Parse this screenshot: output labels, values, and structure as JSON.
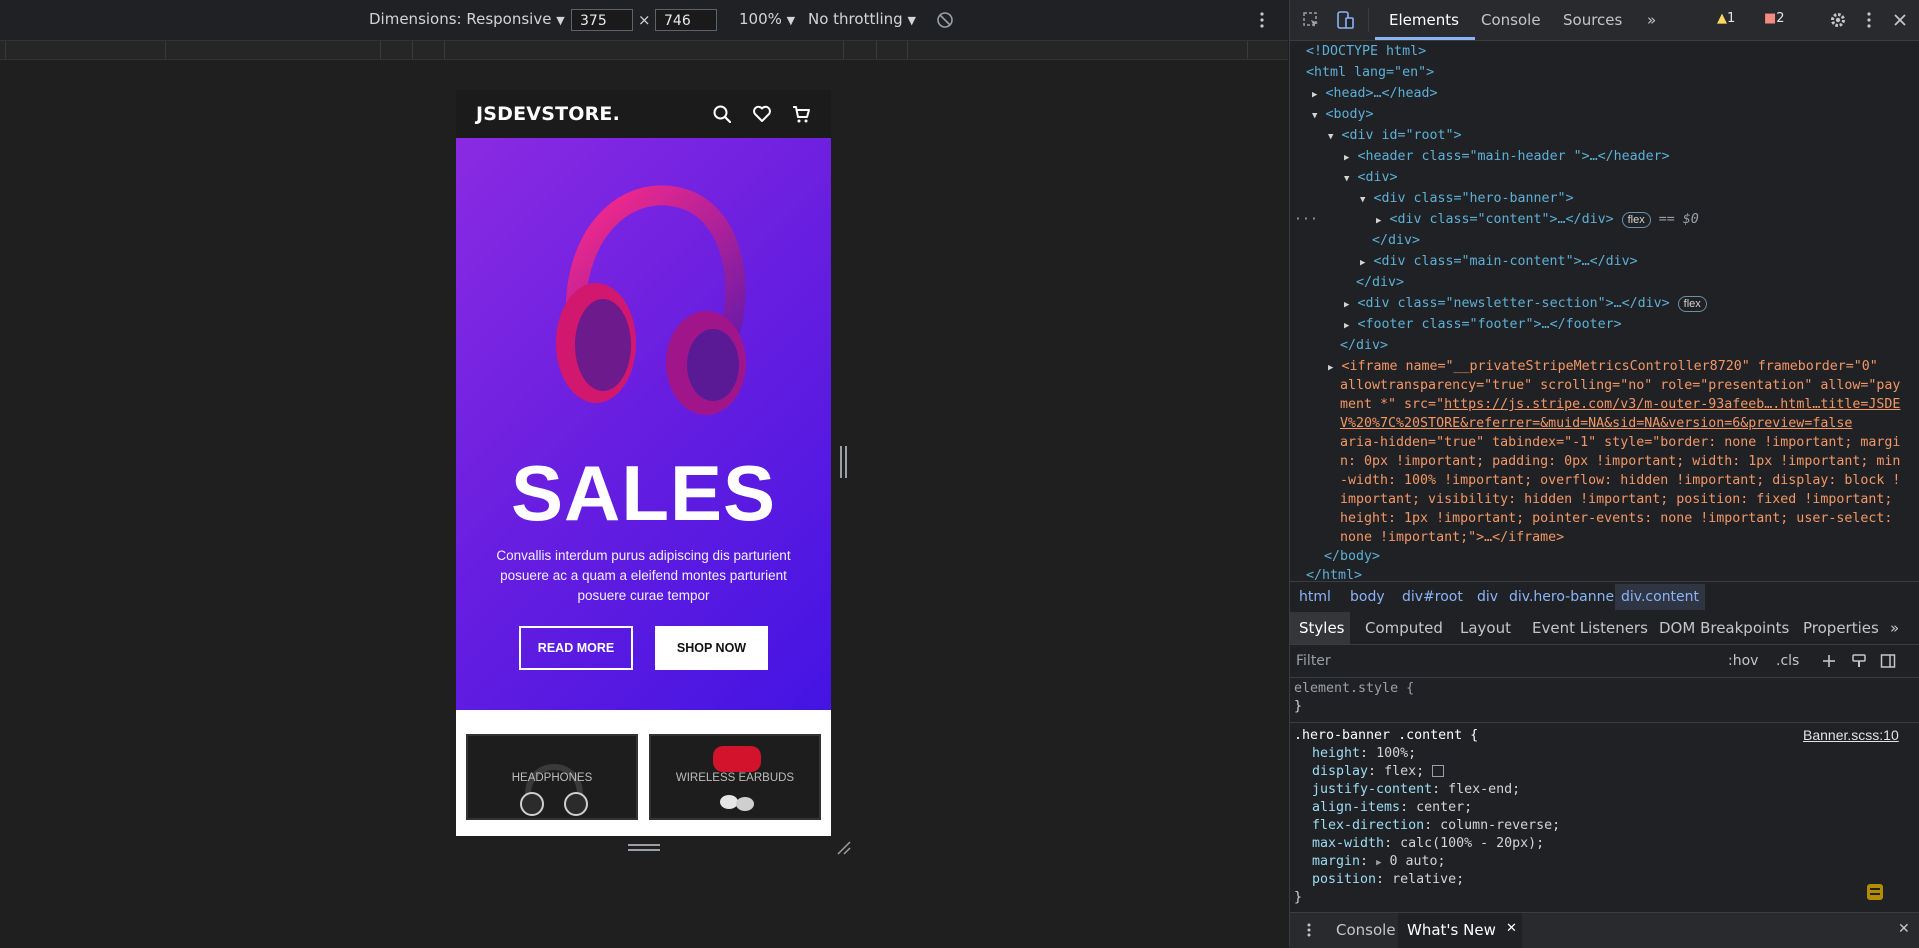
{
  "device_toolbar": {
    "dimensions_label": "Dimensions: Responsive",
    "width_value": "375",
    "times": "×",
    "height_value": "746",
    "zoom": "100%",
    "throttling": "No throttling",
    "caret": "▼"
  },
  "site": {
    "logo": "JSDEVSTORE.",
    "hero_title": "SALES",
    "hero_description": "Convallis interdum purus adipiscing dis parturient posuere ac a quam a eleifend montes parturient posuere curae tempor",
    "read_more": "READ MORE",
    "shop_now": "SHOP NOW",
    "categories": [
      "HEADPHONES",
      "WIRELESS EARBUDS"
    ]
  },
  "devtools": {
    "tabs": [
      "Elements",
      "Console",
      "Sources"
    ],
    "more_tabs": "»",
    "warnings": "1",
    "errors": "2",
    "dom": {
      "doctype": "<!DOCTYPE html>",
      "html_open": "<html lang=\"en\">",
      "head": "<head>…</head>",
      "body_open": "<body>",
      "div_root": "<div id=\"root\">",
      "header": "<header class=\"main-header \">…</header>",
      "div_open": "<div>",
      "hero_banner": "<div class=\"hero-banner\">",
      "content": "<div class=\"content\">…</div>",
      "flex_pill": "flex",
      "selected_marker": "== $0",
      "div_close": "</div>",
      "main_content": "<div class=\"main-content\">…</div>",
      "newsletter": "<div class=\"newsletter-section\">…</div>",
      "footer": "<footer class=\"footer\">…</footer>",
      "iframe_1": "<iframe name=\"__privateStripeMetricsController8720\" frameborder=\"0\"",
      "iframe_2": "allowtransparency=\"true\" scrolling=\"no\" role=\"presentation\" allow=\"pay",
      "iframe_3": "ment *\" src=\"",
      "iframe_link_1": "https://js.stripe.com/v3/m-outer-93afeeb….html…title=JSDE",
      "iframe_link_2": "V%20%7C%20STORE&referrer=&muid=NA&sid=NA&version=6&preview=false",
      "iframe_4": "aria-hidden=\"true\" tabindex=\"-1\" style=\"border: none !important; margi",
      "iframe_5": "n: 0px !important; padding: 0px !important; width: 1px !important; min",
      "iframe_6": "-width: 100% !important; overflow: hidden !important; display: block !",
      "iframe_7": "important; visibility: hidden !important; position: fixed !important;",
      "iframe_8": "height: 1px !important; pointer-events: none !important; user-select:",
      "iframe_9": "none !important;\">…</iframe>",
      "body_close": "</body>",
      "html_close": "</html>",
      "ellipsis": "···"
    },
    "breadcrumbs": [
      "html",
      "body",
      "div#root",
      "div",
      "div.hero-banner",
      "div.content"
    ],
    "styles_tabs": [
      "Styles",
      "Computed",
      "Layout",
      "Event Listeners",
      "DOM Breakpoints",
      "Properties"
    ],
    "filter_placeholder": "Filter",
    "hov": ":hov",
    "cls": ".cls",
    "element_style": "element.style {",
    "close_brace": "}",
    "rule_selector": ".hero-banner .content {",
    "rule_source": "Banner.scss:10",
    "declarations": [
      {
        "prop": "height",
        "value": "100%;"
      },
      {
        "prop": "display",
        "value": "flex;"
      },
      {
        "prop": "justify-content",
        "value": "flex-end;"
      },
      {
        "prop": "align-items",
        "value": "center;"
      },
      {
        "prop": "flex-direction",
        "value": "column-reverse;"
      },
      {
        "prop": "max-width",
        "value": "calc(100% - 20px);"
      },
      {
        "prop": "margin",
        "value": "0 auto;"
      },
      {
        "prop": "position",
        "value": "relative;"
      }
    ],
    "drawer_tabs": [
      "Console",
      "What's New"
    ],
    "close_x": "✕"
  },
  "colors": {
    "hero_start": "#8a2be2",
    "hero_end": "#4414e3",
    "devtools_bg": "#202124",
    "tag_color": "#5db0d7",
    "attr_value_color": "#f29766"
  }
}
